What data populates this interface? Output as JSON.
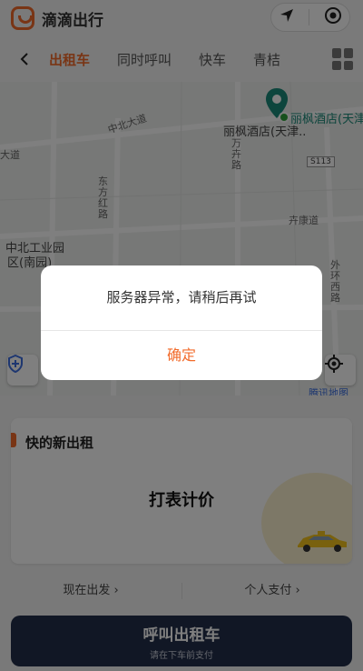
{
  "app": {
    "name": "滴滴出行"
  },
  "tabs": [
    "出租车",
    "同时呼叫",
    "快车",
    "青桔"
  ],
  "map": {
    "roads": [
      "中北大道",
      "大道",
      "东方红路",
      "万卉路",
      "卉康道",
      "外环西路"
    ],
    "shield": "S113",
    "areas": [
      "中北工业园",
      "区(南园)"
    ],
    "poi_pin": "丽枫酒店(天津",
    "poi_name": "丽枫酒店(天津..",
    "partial_label": "腾讯地图"
  },
  "card": {
    "title": "快的新出租",
    "price_mode": "打表计价"
  },
  "options": {
    "depart": "现在出发 ›",
    "payment": "个人支付 ›"
  },
  "call_button": {
    "title": "呼叫出租车",
    "subtitle": "请在下车前支付"
  },
  "dialog": {
    "message": "服务器异常，请稍后再试",
    "confirm": "确定"
  },
  "colors": {
    "accent": "#f26b2b",
    "primary_button": "#232f4a",
    "poi": "#1a8a7a"
  }
}
